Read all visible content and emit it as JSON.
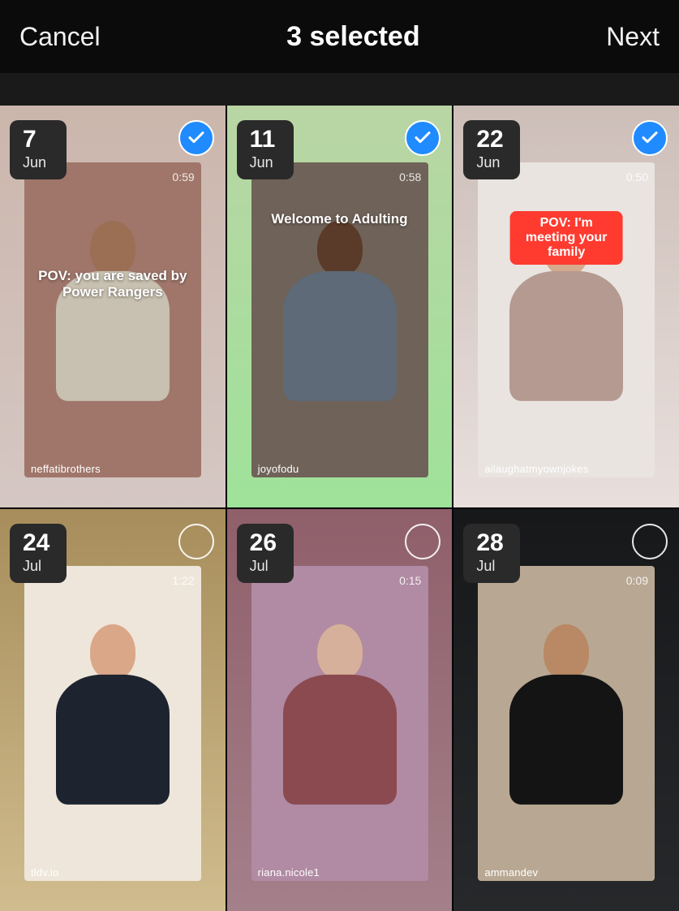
{
  "header": {
    "cancel": "Cancel",
    "title": "3 selected",
    "next": "Next"
  },
  "items": [
    {
      "day": "7",
      "month": "Jun",
      "duration": "0:59",
      "username": "neffatibrothers",
      "caption": "POV: you are saved by Power Rangers",
      "caption_style": "plain2",
      "selected": true,
      "bg": [
        "#cbb6ac",
        "#d5c7c3"
      ],
      "inner_bg": "#a0766a",
      "skin": "#9a6f54",
      "shirt": "#c8c0b0",
      "pants": "#3a3a3a"
    },
    {
      "day": "11",
      "month": "Jun",
      "duration": "0:58",
      "username": "joyofodu",
      "caption": "Welcome to Adulting",
      "caption_style": "plain",
      "selected": true,
      "bg": [
        "#b9d5a4",
        "#9fe29a"
      ],
      "inner_bg": "#6f6258",
      "skin": "#5a3a28",
      "shirt": "#5e6a78",
      "pants": "#5e6a78"
    },
    {
      "day": "22",
      "month": "Jun",
      "duration": "0:50",
      "username": "ailaughatmyownjokes",
      "caption": "POV: I'm meeting your family",
      "caption_style": "red",
      "selected": true,
      "bg": [
        "#cdbeb8",
        "#e8dfdc"
      ],
      "inner_bg": "#e9e4e0",
      "skin": "#d6a98c",
      "shirt": "#b59a92",
      "pants": "#6f87a9"
    },
    {
      "day": "24",
      "month": "Jul",
      "duration": "1:22",
      "username": "tldv.io",
      "caption": "",
      "caption_style": "plain",
      "selected": false,
      "bg": [
        "#a78d5b",
        "#d0bc8e"
      ],
      "inner_bg": "#eee6da",
      "skin": "#dba789",
      "shirt": "#1d2430",
      "pants": "#1d2430"
    },
    {
      "day": "26",
      "month": "Jul",
      "duration": "0:15",
      "username": "riana.nicole1",
      "caption": "",
      "caption_style": "plain",
      "selected": false,
      "bg": [
        "#8f5f6a",
        "#a4808a"
      ],
      "inner_bg": "#b18aa3",
      "skin": "#d6b09a",
      "shirt": "#8a4a50",
      "pants": "#2a2a2a"
    },
    {
      "day": "28",
      "month": "Jul",
      "duration": "0:09",
      "username": "ammandev",
      "caption": "",
      "caption_style": "plain",
      "selected": false,
      "bg": [
        "#17181a",
        "#26282b"
      ],
      "inner_bg": "#b8a893",
      "skin": "#b98864",
      "shirt": "#141414",
      "pants": "#141414"
    }
  ]
}
